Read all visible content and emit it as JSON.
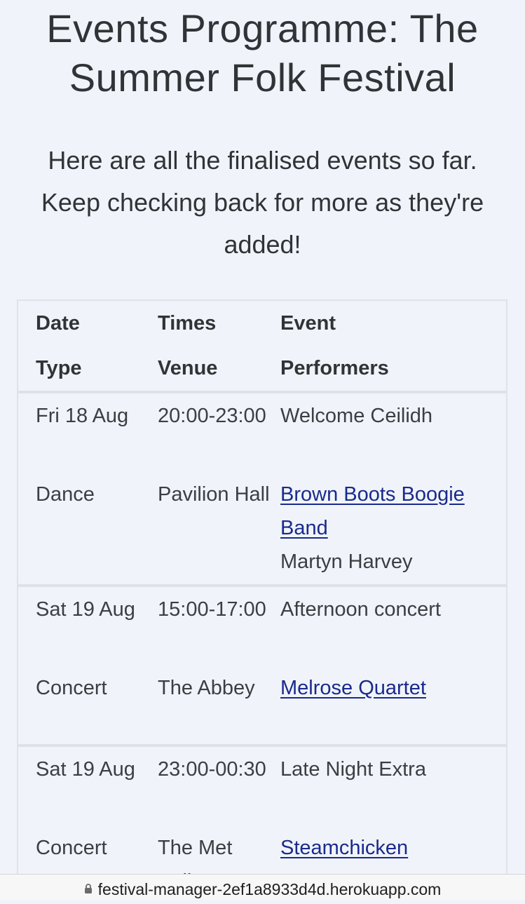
{
  "page": {
    "title": "Events Programme: The Summer Folk Festival",
    "intro": "Here are all the finalised events so far. Keep checking back for more as they're added!"
  },
  "table": {
    "headers": {
      "date": "Date",
      "times": "Times",
      "event": "Event",
      "type": "Type",
      "venue": "Venue",
      "performers": "Performers"
    },
    "rows": [
      {
        "date": "Fri 18 Aug",
        "times": "20:00-23:00",
        "event": "Welcome Ceilidh",
        "type": "Dance",
        "venue": "Pavilion Hall",
        "performers": [
          {
            "name": "Brown Boots Boogie Band",
            "link": true
          },
          {
            "name": "Martyn Harvey",
            "link": false
          }
        ]
      },
      {
        "date": "Sat 19 Aug",
        "times": "15:00-17:00",
        "event": "Afternoon concert",
        "type": "Concert",
        "venue": "The Abbey",
        "performers": [
          {
            "name": "Melrose Quartet",
            "link": true
          }
        ]
      },
      {
        "date": "Sat 19 Aug",
        "times": "23:00-00:30",
        "event": "Late Night Extra",
        "type": "Concert",
        "venue": "The Met Ballroom",
        "performers": [
          {
            "name": "Steamchicken",
            "link": true
          }
        ]
      }
    ]
  },
  "browser": {
    "url": "festival-manager-2ef1a8933d4d.herokuapp.com",
    "lock_icon": "lock-icon"
  }
}
